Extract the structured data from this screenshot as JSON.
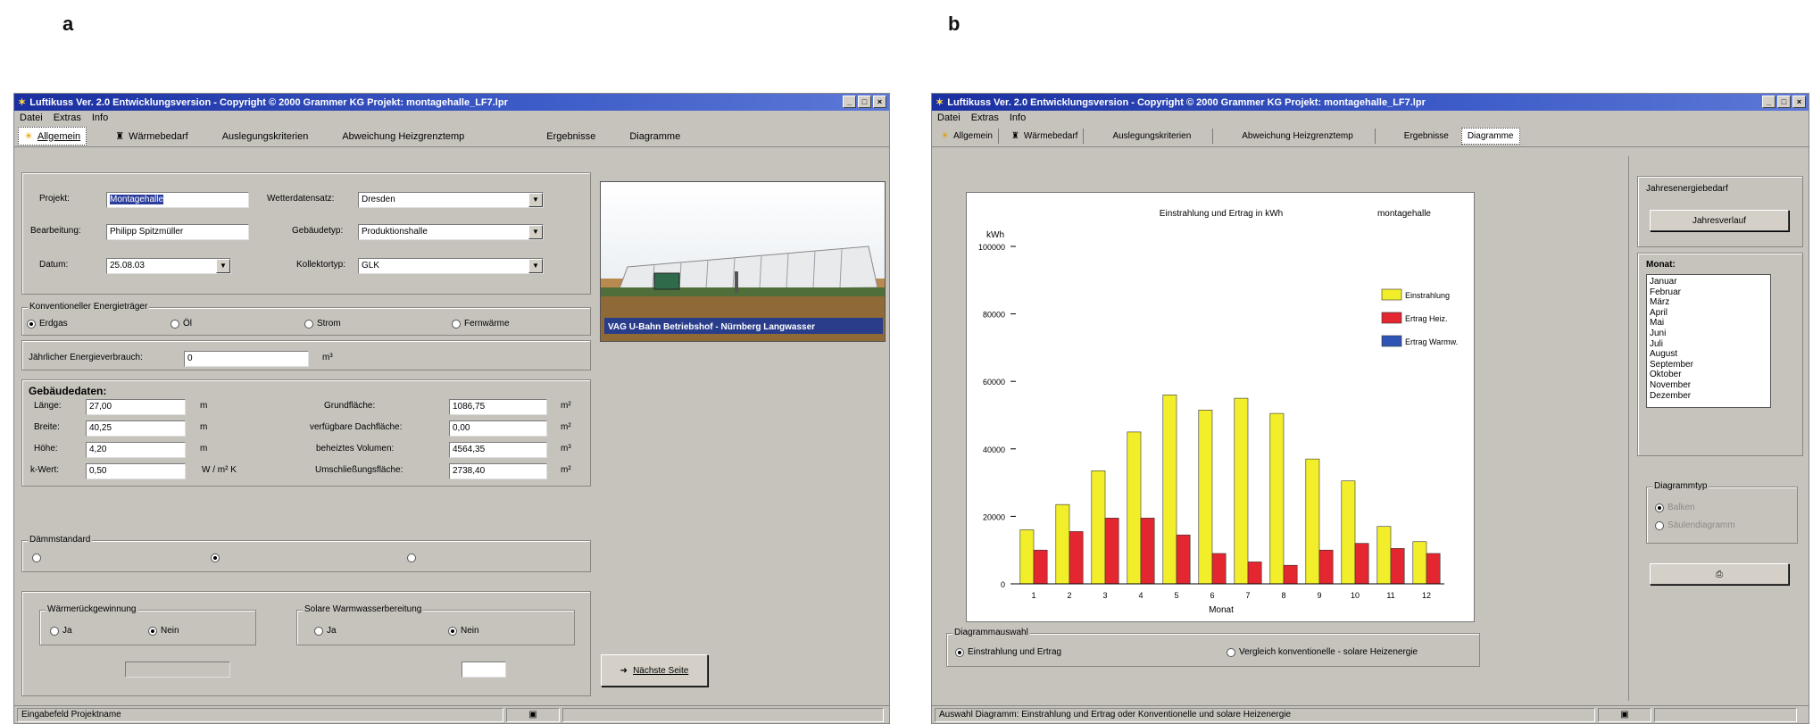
{
  "panel_labels": {
    "a": "a",
    "b": "b"
  },
  "window_a": {
    "title": "Luftikuss Ver. 2.0 Entwicklungsversion - Copyright © 2000 Grammer KG Projekt: montagehalle_LF7.lpr",
    "menu": [
      "Datei",
      "Extras",
      "Info"
    ],
    "tabs": [
      "Allgemein",
      "Wärmebedarf",
      "Auslegungskriterien",
      "Abweichung Heizgrenztemp",
      "Ergebnisse",
      "Diagramme"
    ],
    "project": {
      "projekt_label": "Projekt:",
      "projekt_value": "Montagehalle",
      "bearbeitung_label": "Bearbeitung:",
      "bearbeitung_value": "Philipp Spitzmüller",
      "datum_label": "Datum:",
      "datum_value": "25.08.03",
      "wetter_label": "Wetterdatensatz:",
      "wetter_value": "Dresden",
      "gebaeude_label": "Gebäudetyp:",
      "gebaeude_value": "Produktionshalle",
      "kollektor_label": "Kollektortyp:",
      "kollektor_value": "GLK"
    },
    "photo_caption": "VAG U-Bahn Betriebshof - Nürnberg Langwasser",
    "energy": {
      "legend": "Konventioneller Energieträger",
      "options": [
        "Erdgas",
        "Öl",
        "Strom",
        "Fernwärme"
      ],
      "verbrauch_label": "Jährlicher Energieverbrauch:",
      "verbrauch_value": "0",
      "verbrauch_unit": "m³"
    },
    "building": {
      "title": "Gebäudedaten:",
      "left": [
        {
          "label": "Länge:",
          "value": "27,00",
          "unit": "m"
        },
        {
          "label": "Breite:",
          "value": "40,25",
          "unit": "m"
        },
        {
          "label": "Höhe:",
          "value": "4,20",
          "unit": "m"
        },
        {
          "label": "k-Wert:",
          "value": "0,50",
          "unit": "W / m² K"
        }
      ],
      "right": [
        {
          "label": "Grundfläche:",
          "value": "1086,75",
          "unit": "m²"
        },
        {
          "label": "verfügbare Dachfläche:",
          "value": "0,00",
          "unit": "m²"
        },
        {
          "label": "beheiztes Volumen:",
          "value": "4564,35",
          "unit": "m³"
        },
        {
          "label": "Umschließungsfläche:",
          "value": "2738,40",
          "unit": "m²"
        }
      ]
    },
    "daemm": {
      "legend": "Dämmstandard"
    },
    "waerme": {
      "legend": "Wärmerückgewinnung",
      "ja": "Ja",
      "nein": "Nein"
    },
    "solar": {
      "legend": "Solare Warmwasserbereitung",
      "ja": "Ja",
      "nein": "Nein"
    },
    "next_button": "Nächste Seite",
    "status": "Eingabefeld Projektname"
  },
  "window_b": {
    "title": "Luftikuss Ver. 2.0 Entwicklungsversion - Copyright © 2000 Grammer KG Projekt: montagehalle_LF7.lpr",
    "menu": [
      "Datei",
      "Extras",
      "Info"
    ],
    "tabs": [
      "Allgemein",
      "Wärmebedarf",
      "Auslegungskriterien",
      "Abweichung Heizgrenztemp",
      "Ergebnisse",
      "Diagramme"
    ],
    "jahres_label": "Jahresenergiebedarf",
    "jahres_button": "Jahresverlauf",
    "monat_label": "Monat:",
    "months": [
      "Januar",
      "Februar",
      "März",
      "April",
      "Mai",
      "Juni",
      "Juli",
      "August",
      "September",
      "Oktober",
      "November",
      "Dezember"
    ],
    "diagrammtyp_label": "Diagrammtyp",
    "diagrammtyp_options": [
      "Balken",
      "Säulendiagramm"
    ],
    "diagram_group_label": "Diagrammauswahl",
    "diagram_options": [
      "Einstrahlung und Ertrag",
      "Vergleich konventionelle - solare Heizenergie"
    ],
    "status": "Auswahl Diagramm: Einstrahlung und Ertrag oder Konventionelle und solare Heizenergie"
  },
  "chart_data": {
    "type": "bar",
    "title": "Einstrahlung und Ertrag in kWh",
    "subtitle": "montagehalle",
    "ylabel": "kWh",
    "xlabel": "Monat",
    "ylim": [
      0,
      100000
    ],
    "yticks": [
      0,
      20000,
      40000,
      60000,
      80000,
      100000
    ],
    "categories": [
      "1",
      "2",
      "3",
      "4",
      "5",
      "6",
      "7",
      "8",
      "9",
      "10",
      "11",
      "12"
    ],
    "series": [
      {
        "name": "Einstrahlung",
        "color": "#f2ee2a",
        "values": [
          16000,
          23500,
          33500,
          45000,
          56000,
          51500,
          55000,
          50500,
          37000,
          30500,
          17000,
          12500
        ]
      },
      {
        "name": "Ertrag Heiz.",
        "color": "#e32630",
        "values": [
          10000,
          15500,
          19500,
          19500,
          14500,
          9000,
          6500,
          5500,
          10000,
          12000,
          10500,
          9000
        ]
      },
      {
        "name": "Ertrag Warmw.",
        "color": "#2f54b5",
        "values": [
          0,
          0,
          0,
          0,
          0,
          0,
          0,
          0,
          0,
          0,
          0,
          0
        ]
      }
    ]
  }
}
